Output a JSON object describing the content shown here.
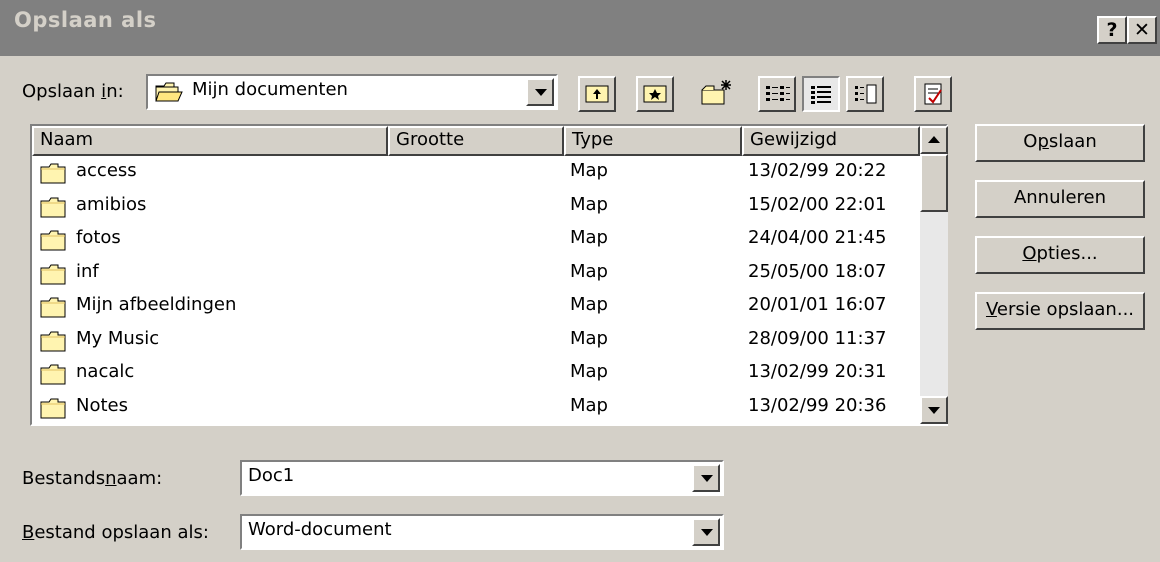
{
  "window": {
    "title": "Opslaan als",
    "help_button": "?",
    "close_button": "✕"
  },
  "savein": {
    "label_pre": "Opslaan ",
    "label_u": "i",
    "label_post": "n:",
    "value": "Mijn documenten"
  },
  "toolbar": [
    "up-one-level",
    "favorites",
    "new-folder",
    "list-view",
    "details-view",
    "properties-view",
    "tools"
  ],
  "columns": [
    "Naam",
    "Grootte",
    "Type",
    "Gewijzigd"
  ],
  "files": [
    {
      "name": "access",
      "size": "",
      "type": "Map",
      "modified": "13/02/99 20:22"
    },
    {
      "name": "amibios",
      "size": "",
      "type": "Map",
      "modified": "15/02/00 22:01"
    },
    {
      "name": "fotos",
      "size": "",
      "type": "Map",
      "modified": "24/04/00 21:45"
    },
    {
      "name": "inf",
      "size": "",
      "type": "Map",
      "modified": "25/05/00 18:07"
    },
    {
      "name": "Mijn afbeeldingen",
      "size": "",
      "type": "Map",
      "modified": "20/01/01 16:07"
    },
    {
      "name": "My Music",
      "size": "",
      "type": "Map",
      "modified": "28/09/00 11:37"
    },
    {
      "name": "nacalc",
      "size": "",
      "type": "Map",
      "modified": "13/02/99 20:31"
    },
    {
      "name": "Notes",
      "size": "",
      "type": "Map",
      "modified": "13/02/99 20:36"
    }
  ],
  "buttons": {
    "save": {
      "pre": "O",
      "u": "p",
      "post": "slaan"
    },
    "cancel": {
      "pre": "Annuleren",
      "u": "",
      "post": ""
    },
    "options": {
      "pre": "",
      "u": "O",
      "post": "pties..."
    },
    "save_version": {
      "pre": "",
      "u": "V",
      "post": "ersie opslaan..."
    }
  },
  "filename": {
    "label_pre": "Bestands",
    "label_u": "n",
    "label_post": "aam:",
    "value": "Doc1"
  },
  "filetype": {
    "label_pre": "",
    "label_u": "B",
    "label_post": "estand opslaan als:",
    "value": "Word-document"
  }
}
